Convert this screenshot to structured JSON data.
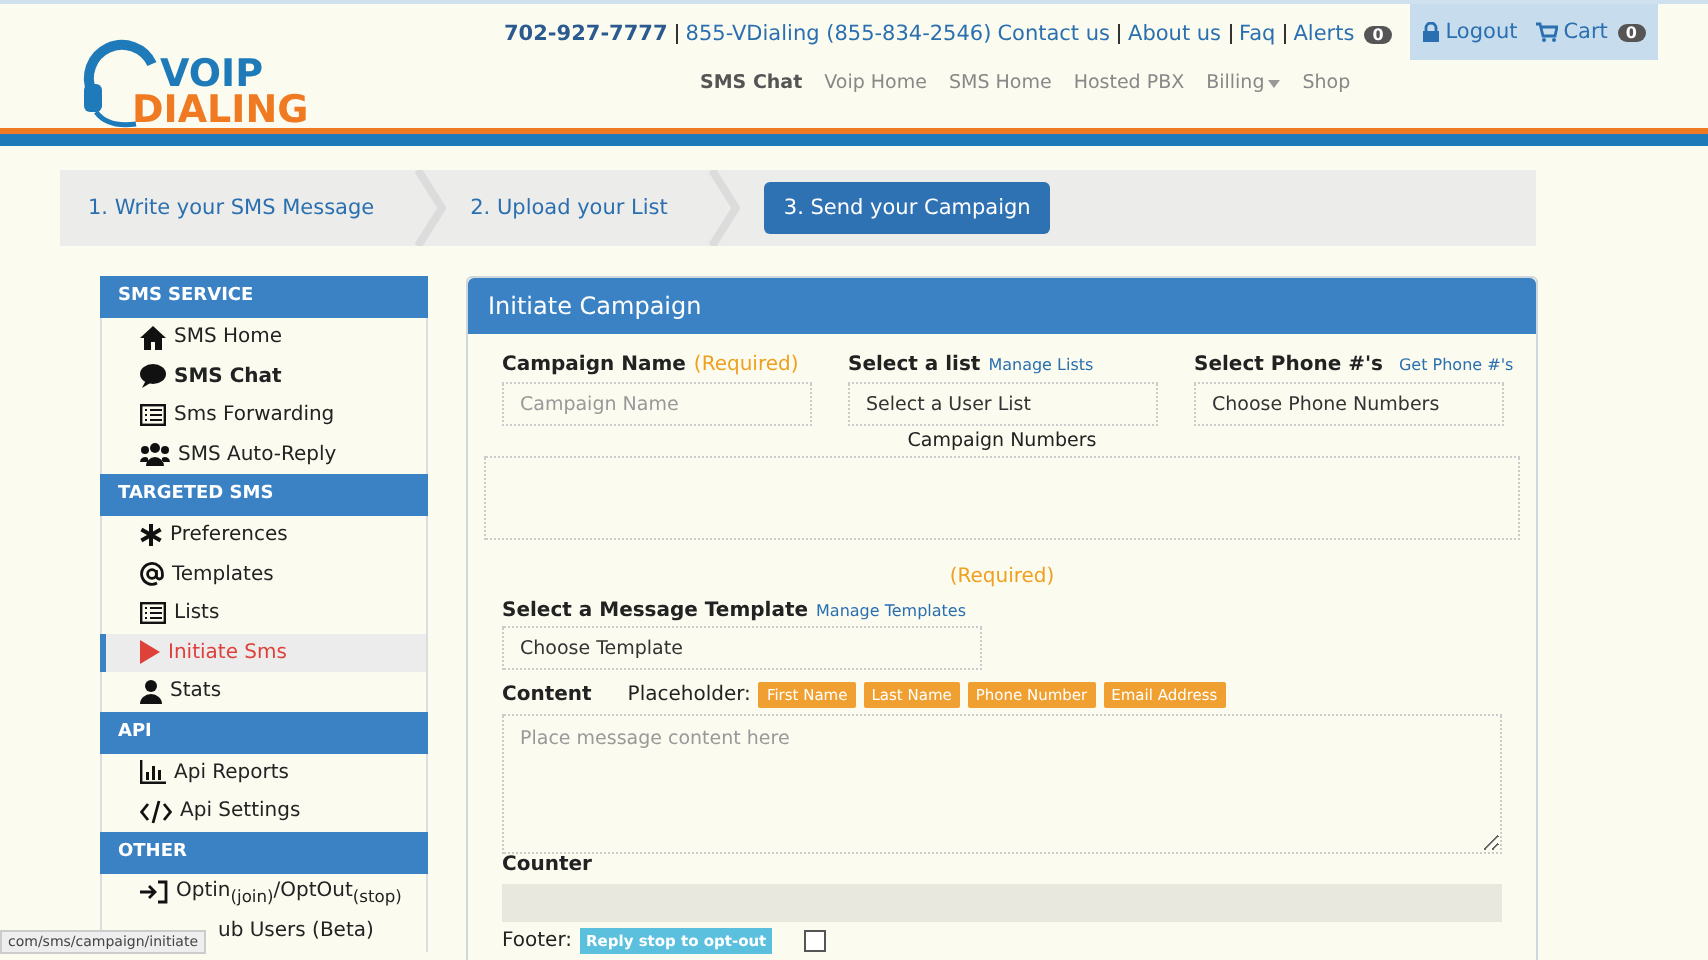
{
  "header": {
    "phone": "702-927-7777",
    "toll_free": "855-VDialing (855-834-2546)",
    "links": [
      "Contact us",
      "About us",
      "Faq"
    ],
    "alerts": {
      "label": "Alerts",
      "count": "0"
    },
    "logout": "Logout",
    "cart": {
      "label": "Cart",
      "count": "0"
    },
    "logo": {
      "line1": "VOIP",
      "line2": "DIALING"
    },
    "nav": [
      {
        "label": "SMS Chat",
        "selected": true,
        "dropdown": false
      },
      {
        "label": "Voip Home",
        "selected": false,
        "dropdown": false
      },
      {
        "label": "SMS Home",
        "selected": false,
        "dropdown": false
      },
      {
        "label": "Hosted PBX",
        "selected": false,
        "dropdown": false
      },
      {
        "label": "Billing",
        "selected": false,
        "dropdown": true
      },
      {
        "label": "Shop",
        "selected": false,
        "dropdown": false
      }
    ]
  },
  "steps": [
    {
      "label": "1. Write your SMS Message",
      "selected": false
    },
    {
      "label": "2. Upload your List",
      "selected": false
    },
    {
      "label": "3. Send your Campaign",
      "selected": true
    }
  ],
  "sidebar": [
    {
      "title": "SMS SERVICE",
      "items": [
        {
          "label": "SMS Home",
          "kind": "home",
          "bold": false,
          "selected": false
        },
        {
          "label": "SMS Chat",
          "kind": "chat",
          "bold": true,
          "selected": false
        },
        {
          "label": "Sms Forwarding",
          "kind": "list",
          "bold": false,
          "selected": false
        },
        {
          "label": "SMS Auto-Reply",
          "kind": "users",
          "bold": false,
          "selected": false
        }
      ]
    },
    {
      "title": "TARGETED SMS",
      "items": [
        {
          "label": "Preferences",
          "kind": "asterisk",
          "bold": false,
          "selected": false
        },
        {
          "label": "Templates",
          "kind": "at",
          "bold": false,
          "selected": false
        },
        {
          "label": "Lists",
          "kind": "list",
          "bold": false,
          "selected": false
        },
        {
          "label": "Initiate Sms",
          "kind": "play",
          "bold": false,
          "selected": true
        },
        {
          "label": "Stats",
          "kind": "user",
          "bold": false,
          "selected": false
        }
      ]
    },
    {
      "title": "API",
      "items": [
        {
          "label": "Api Reports",
          "kind": "chart",
          "bold": false,
          "selected": false
        },
        {
          "label": "Api Settings",
          "kind": "code",
          "bold": false,
          "selected": false
        }
      ]
    },
    {
      "title": "OTHER",
      "items": [
        {
          "label": "Optin$_{(join)}$/OptOut$_{(stop)}$",
          "kind": "signin",
          "bold": false,
          "selected": false
        },
        {
          "label": "ub Users (Beta)",
          "kind": "covered",
          "bold": false,
          "selected": false
        }
      ]
    }
  ],
  "panel": {
    "title": "Initiate Campaign",
    "campaign_name": {
      "label": "Campaign Name",
      "required": "(Required)",
      "placeholder": "Campaign Name"
    },
    "list": {
      "label": "Select a list",
      "link": "Manage Lists",
      "value": "Select a User List"
    },
    "phones": {
      "label": "Select Phone #'s",
      "link": "Get Phone #'s",
      "value": "Choose Phone Numbers"
    },
    "campaign_numbers": "Campaign Numbers",
    "required": "(Required)",
    "template": {
      "label": "Select a Message Template",
      "link": "Manage Templates",
      "value": "Choose Template"
    },
    "content": {
      "label": "Content",
      "placeholder_label": "Placeholder:",
      "tags": [
        "First Name",
        "Last Name",
        "Phone Number",
        "Email Address"
      ],
      "placeholder": "Place message content here"
    },
    "counter": "Counter",
    "footer": {
      "label": "Footer:",
      "tag": "Reply stop to opt-out",
      "checked": false
    }
  },
  "status_url": "com/sms/campaign/initiate"
}
